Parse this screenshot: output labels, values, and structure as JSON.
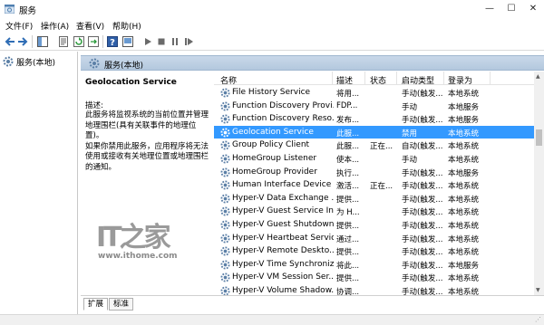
{
  "window": {
    "title": "服务",
    "minimize": "—",
    "maximize": "☐",
    "close": "✕"
  },
  "menu": [
    "文件(F)",
    "操作(A)",
    "查看(V)",
    "帮助(H)"
  ],
  "toolbar_icons": [
    "back-icon",
    "forward-icon",
    "show-tree-icon",
    "properties-icon",
    "refresh-icon",
    "export-icon",
    "help-icon",
    "console-icon",
    "start-icon",
    "stop-icon",
    "pause-icon",
    "restart-icon"
  ],
  "tree": {
    "root_label": "服务(本地)"
  },
  "panel": {
    "header_label": "服务(本地)"
  },
  "description": {
    "service_name": "Geolocation Service",
    "label": "描述:",
    "lines": [
      "此服务将监视系统的当前位置并管理",
      "地理围栏(具有关联事件的地理位置)。",
      "如果你禁用此服务，应用程序将无法",
      "使用或接收有关地理位置或地理围栏",
      "的通知。"
    ]
  },
  "columns": [
    "名称",
    "描述",
    "状态",
    "启动类型",
    "登录为"
  ],
  "rows": [
    {
      "name": "File History Service",
      "desc": "将用...",
      "status": "",
      "startup": "手动(触发...",
      "logon": "本地系统"
    },
    {
      "name": "Function Discovery Provi...",
      "desc": "FDP...",
      "status": "",
      "startup": "手动",
      "logon": "本地服务"
    },
    {
      "name": "Function Discovery Reso...",
      "desc": "发布...",
      "status": "",
      "startup": "手动(触发...",
      "logon": "本地服务"
    },
    {
      "name": "Geolocation Service",
      "desc": "此服...",
      "status": "",
      "startup": "禁用",
      "logon": "本地系统",
      "selected": true
    },
    {
      "name": "Group Policy Client",
      "desc": "此服...",
      "status": "正在...",
      "startup": "自动(触发...",
      "logon": "本地系统"
    },
    {
      "name": "HomeGroup Listener",
      "desc": "使本...",
      "status": "",
      "startup": "手动",
      "logon": "本地系统"
    },
    {
      "name": "HomeGroup Provider",
      "desc": "执行...",
      "status": "",
      "startup": "手动(触发...",
      "logon": "本地服务"
    },
    {
      "name": "Human Interface Device ...",
      "desc": "激活...",
      "status": "正在...",
      "startup": "手动(触发...",
      "logon": "本地系统"
    },
    {
      "name": "Hyper-V Data Exchange ...",
      "desc": "提供...",
      "status": "",
      "startup": "手动(触发...",
      "logon": "本地系统"
    },
    {
      "name": "Hyper-V Guest Service In...",
      "desc": "为 H...",
      "status": "",
      "startup": "手动(触发...",
      "logon": "本地系统"
    },
    {
      "name": "Hyper-V Guest Shutdown...",
      "desc": "提供...",
      "status": "",
      "startup": "手动(触发...",
      "logon": "本地系统"
    },
    {
      "name": "Hyper-V Heartbeat Service",
      "desc": "通过...",
      "status": "",
      "startup": "手动(触发...",
      "logon": "本地系统"
    },
    {
      "name": "Hyper-V Remote Deskto...",
      "desc": "提供...",
      "status": "",
      "startup": "手动(触发...",
      "logon": "本地系统"
    },
    {
      "name": "Hyper-V Time Synchroniz...",
      "desc": "将此...",
      "status": "",
      "startup": "手动(触发...",
      "logon": "本地服务"
    },
    {
      "name": "Hyper-V VM Session Ser...",
      "desc": "提供...",
      "status": "",
      "startup": "手动(触发...",
      "logon": "本地系统"
    },
    {
      "name": "Hyper-V Volume Shadow...",
      "desc": "协调...",
      "status": "",
      "startup": "手动(触发...",
      "logon": "本地系统"
    }
  ],
  "tabs": [
    "扩展",
    "标准"
  ],
  "watermark": {
    "logo": "IT之家",
    "url": "www.ithome.com"
  },
  "colors": {
    "selection": "#3399ff",
    "header_band": "#b8cbe0",
    "gear": "#5b7fa6"
  }
}
